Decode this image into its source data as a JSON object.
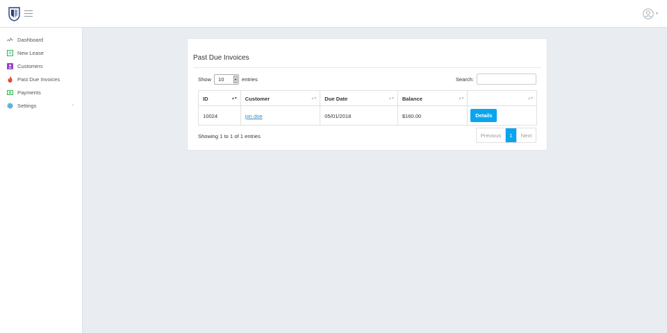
{
  "header": {
    "logo_icon": "shield-logo-icon",
    "menu_icon": "hamburger-icon",
    "user_icon": "user-avatar-icon"
  },
  "sidebar": {
    "items": [
      {
        "label": "Dashboard",
        "icon": "activity-icon",
        "color": "#7a8391"
      },
      {
        "label": "New Lease",
        "icon": "document-icon",
        "color": "#2ab34a"
      },
      {
        "label": "Customers",
        "icon": "person-icon",
        "color": "#8e44c9"
      },
      {
        "label": "Past Due Invoices",
        "icon": "fire-icon",
        "color": "#e8452c"
      },
      {
        "label": "Payments",
        "icon": "money-icon",
        "color": "#2ab34a"
      },
      {
        "label": "Settings",
        "icon": "gear-icon",
        "color": "#1e8fd8"
      }
    ]
  },
  "panel": {
    "title": "Past Due Invoices",
    "show_label": "Show",
    "entries_value": "10",
    "entries_label": "entries",
    "search_label": "Search:",
    "search_value": "",
    "columns": [
      "ID",
      "Customer",
      "Due Date",
      "Balance",
      ""
    ],
    "rows": [
      {
        "id": "10024",
        "customer": "jon doe",
        "due_date": "05/01/2018",
        "balance": "$160.00",
        "action": "Details"
      }
    ],
    "info": "Showing 1 to 1 of 1 entries",
    "pagination": {
      "previous": "Previous",
      "current": "1",
      "next": "Next"
    }
  },
  "colors": {
    "accent": "#0aa5ef",
    "link": "#2f8ccb",
    "background": "#e9edf2"
  }
}
